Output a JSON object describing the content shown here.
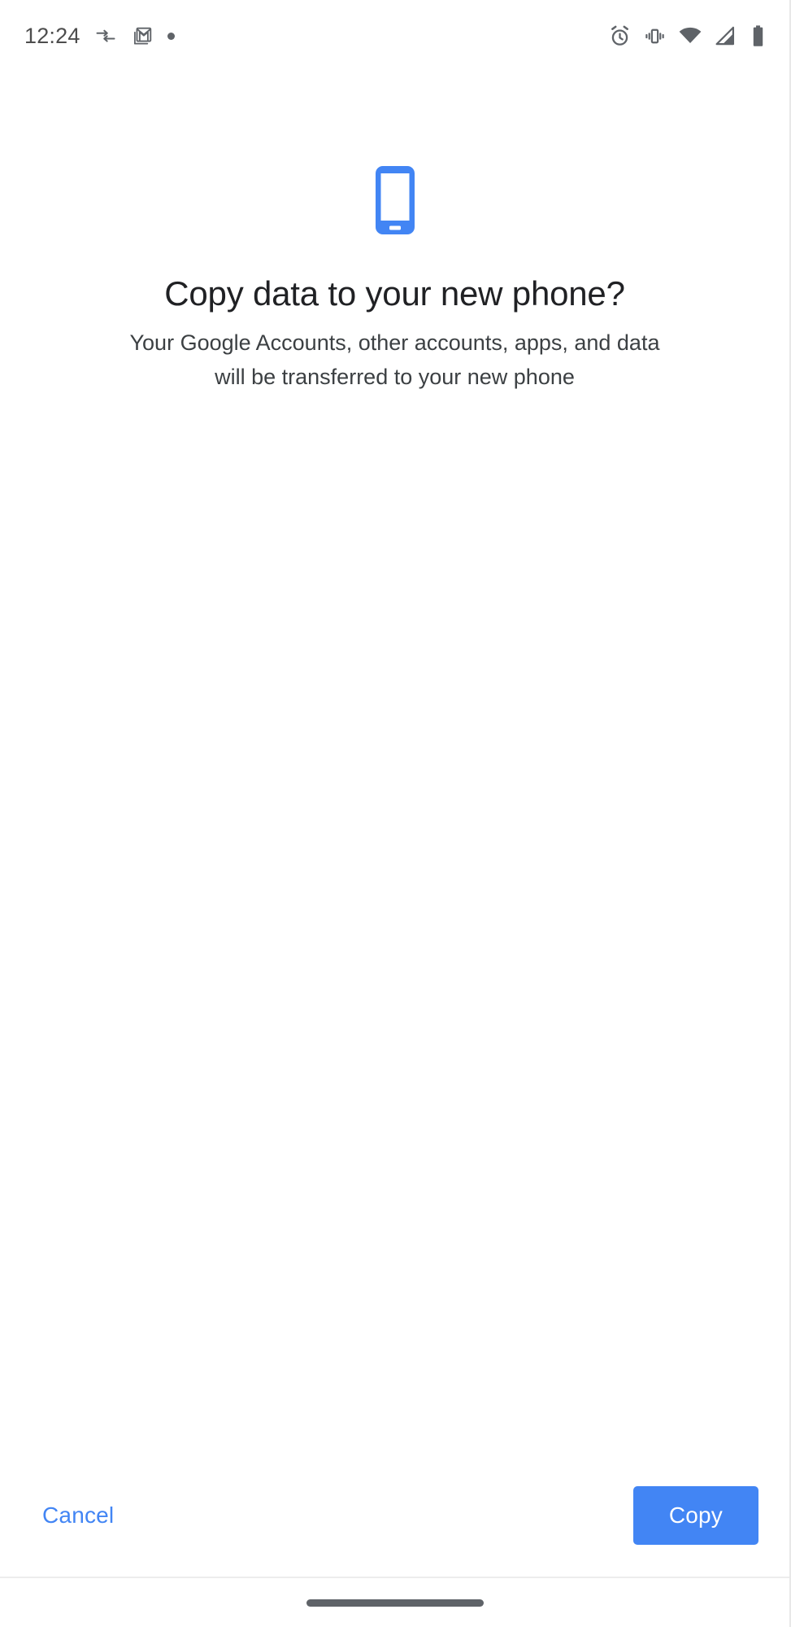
{
  "status_bar": {
    "clock": "12:24",
    "left_icons": [
      {
        "name": "data-transfer-icon",
        "label": "Data transfer"
      },
      {
        "name": "gmail-icon",
        "label": "Gmail"
      },
      {
        "name": "notification-dot-icon",
        "label": "Notification"
      }
    ],
    "right_icons": [
      {
        "name": "alarm-icon",
        "label": "Alarm set"
      },
      {
        "name": "vibrate-icon",
        "label": "Vibrate mode"
      },
      {
        "name": "wifi-icon",
        "label": "Wi-Fi"
      },
      {
        "name": "cellular-signal-icon",
        "label": "Mobile signal"
      },
      {
        "name": "battery-icon",
        "label": "Battery"
      }
    ]
  },
  "main": {
    "hero_icon": "smartphone-icon",
    "title": "Copy data to your new phone?",
    "subtitle": "Your Google Accounts, other accounts, apps, and data will be transferred to your new phone"
  },
  "actions": {
    "cancel_label": "Cancel",
    "copy_label": "Copy"
  },
  "nav_bar": {
    "home_pill": "home-gesture-pill"
  },
  "colors": {
    "accent": "#4285f4",
    "title_text": "#202124",
    "body_text": "#3c4043",
    "status_icon": "#5f6368",
    "background": "#ffffff",
    "nav_pill": "#5f6368",
    "divider": "#ededed"
  }
}
